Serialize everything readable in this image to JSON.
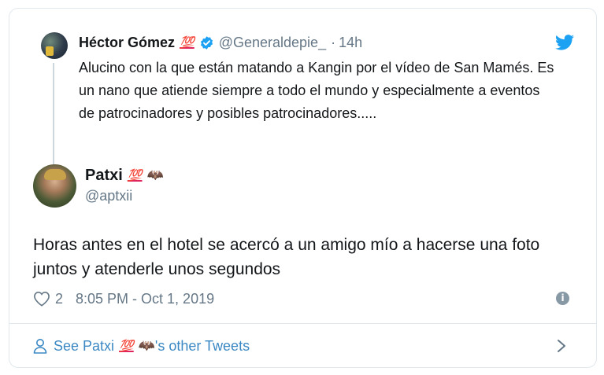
{
  "quoted": {
    "name": "Héctor Gómez",
    "emoji": "💯",
    "handle": "@Generaldepie_",
    "separator": "·",
    "time": "14h",
    "text": "Alucino con la que están matando a Kangin por el vídeo de San Mamés. Es un nano que atiende siempre a todo el mundo y especialmente a eventos de patrocinadores y posibles patrocinadores....."
  },
  "author": {
    "name": "Patxi",
    "emoji": "💯",
    "bat": "🦇",
    "handle": "@aptxii"
  },
  "tweet": {
    "text": "Horas antes en el hotel se acercó a un amigo mío a hacerse una foto juntos y atenderle unos segundos",
    "likes": "2",
    "timestamp": "8:05 PM - Oct 1, 2019"
  },
  "footer": {
    "prefix": "See Patxi",
    "emoji": "💯",
    "bat": "🦇",
    "suffix": "'s other Tweets"
  },
  "icons": {
    "brand": "twitter-bird-icon",
    "verified": "verified-badge-icon",
    "like": "heart-icon",
    "info": "info-icon",
    "person": "person-icon",
    "chevron": "chevron-right-icon"
  },
  "colors": {
    "twitter_blue": "#1da1f2",
    "link_blue": "#3b88c3",
    "muted": "#657786",
    "border": "#e1e8ed"
  }
}
